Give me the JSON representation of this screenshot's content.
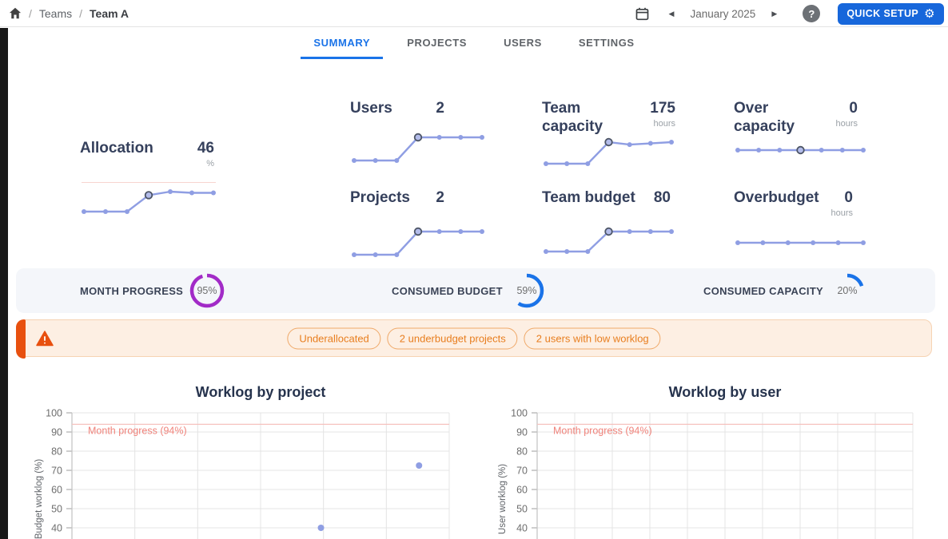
{
  "header": {
    "breadcrumb": {
      "separator": "/",
      "items": [
        {
          "label": "Teams",
          "current": false
        },
        {
          "label": "Team A",
          "current": true
        }
      ]
    },
    "period": {
      "label": "January 2025"
    },
    "quick_setup_label": "QUICK SETUP",
    "colors": {
      "accent_blue": "#1767db",
      "tab_active": "#1a73e8"
    }
  },
  "icons": {
    "gear": "⚙",
    "help": "?",
    "prev": "◀",
    "next": "▶"
  },
  "tabs": [
    {
      "label": "SUMMARY",
      "active": true
    },
    {
      "label": "PROJECTS",
      "active": false
    },
    {
      "label": "USERS",
      "active": false
    },
    {
      "label": "SETTINGS",
      "active": false
    }
  ],
  "metrics": [
    {
      "id": "allocation",
      "label": "Allocation",
      "value": "46",
      "unit": "%",
      "spark": [
        30,
        30,
        30,
        44,
        47,
        46,
        46
      ],
      "highlight_index": 3
    },
    {
      "id": "users",
      "label": "Users",
      "value": "2",
      "unit": "",
      "spark": [
        1,
        1,
        1,
        2,
        2,
        2,
        2
      ],
      "highlight_index": 3
    },
    {
      "id": "team-capacity",
      "label": "Team capacity",
      "value": "175",
      "unit": "hours",
      "spark": [
        88,
        88,
        88,
        175,
        165,
        170,
        175
      ],
      "highlight_index": 3
    },
    {
      "id": "over-capacity",
      "label": "Over capacity",
      "value": "0",
      "unit": "hours",
      "spark": [
        0,
        0,
        0,
        0,
        0,
        0,
        0
      ],
      "highlight_index": 3
    },
    {
      "id": "projects",
      "label": "Projects",
      "value": "2",
      "unit": "",
      "spark": [
        1,
        1,
        1,
        2,
        2,
        2,
        2
      ],
      "highlight_index": 3
    },
    {
      "id": "team-budget",
      "label": "Team budget",
      "value": "80",
      "unit": "",
      "spark": [
        40,
        40,
        40,
        80,
        80,
        80,
        80
      ],
      "highlight_index": 3
    },
    {
      "id": "overbudget",
      "label": "Overbudget",
      "value": "0",
      "unit": "hours",
      "spark": [
        0,
        0,
        0,
        0,
        0,
        0
      ],
      "highlight_index": -1
    }
  ],
  "progress": [
    {
      "label": "MONTH PROGRESS",
      "percent": 95,
      "text": "95%",
      "color": "#a22bc7"
    },
    {
      "label": "CONSUMED BUDGET",
      "percent": 59,
      "text": "59%",
      "color": "#1a73e8"
    },
    {
      "label": "CONSUMED CAPACITY",
      "percent": 20,
      "text": "20%",
      "color": "#1a73e8"
    }
  ],
  "alert": {
    "chips": [
      "Underallocated",
      "2 underbudget projects",
      "2 users with low worklog"
    ]
  },
  "chart_data": [
    {
      "type": "scatter",
      "title": "Worklog by project",
      "ylabel": "Budget worklog (%)",
      "ymax": 100,
      "yticks_visible": [
        100,
        90,
        80,
        70,
        60,
        50,
        40
      ],
      "x_gridline_count": 7,
      "grid": true,
      "legend": false,
      "annotation": {
        "label": "Month progress (94%)",
        "y": 94
      },
      "points": [
        {
          "x_frac": 0.66,
          "y": 40
        },
        {
          "x_frac": 0.92,
          "y": 72.5
        }
      ]
    },
    {
      "type": "scatter",
      "title": "Worklog by user",
      "ylabel": "User worklog (%)",
      "ymax": 100,
      "yticks_visible": [
        100,
        90,
        80,
        70,
        60,
        50,
        40
      ],
      "x_gridline_count": 11,
      "grid": true,
      "legend": false,
      "annotation": {
        "label": "Month progress (94%)",
        "y": 94
      },
      "points": []
    }
  ]
}
